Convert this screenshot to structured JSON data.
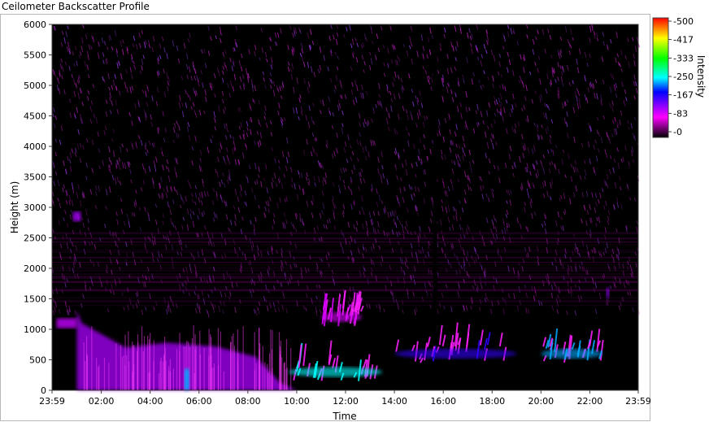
{
  "window": {
    "title": "Ceilometer Backscatter Profile"
  },
  "chart_data": {
    "type": "heatmap",
    "title": "Ceilometer Backscatter Profile",
    "xlabel": "Time",
    "ylabel": "Height (m)",
    "x_ticks": [
      "23:59",
      "02:00",
      "04:00",
      "06:00",
      "08:00",
      "10:00",
      "12:00",
      "14:00",
      "16:00",
      "18:00",
      "20:00",
      "22:00",
      "23:59"
    ],
    "x_range": [
      "23:59",
      "23:59"
    ],
    "y_ticks": [
      0,
      500,
      1000,
      1500,
      2000,
      2500,
      3000,
      3500,
      4000,
      4500,
      5000,
      5500,
      6000
    ],
    "ylim": [
      0,
      6000
    ],
    "colorbar": {
      "label": "Intensity",
      "ticks": [
        500,
        417,
        333,
        250,
        167,
        83,
        0
      ],
      "range": [
        0,
        500
      ],
      "colors": [
        "#000000",
        "#ff00ff",
        "#0000ff",
        "#00ffff",
        "#00ff00",
        "#ffff00",
        "#ff0000"
      ]
    },
    "features": [
      {
        "kind": "boundary-layer",
        "time_start": "01:00",
        "time_end": "10:00",
        "height_top": 800,
        "intensity": 120
      },
      {
        "kind": "residual-layer",
        "time_start": "00:10",
        "time_end": "01:00",
        "height": 1100,
        "intensity": 110
      },
      {
        "kind": "elevated-layer",
        "time_start": "00:50",
        "time_end": "01:10",
        "height": 2850,
        "intensity": 120
      },
      {
        "kind": "cloud-returns",
        "time_start": "09:40",
        "time_end": "13:30",
        "height": 300,
        "intensity": 250
      },
      {
        "kind": "cloud-returns",
        "time_start": "11:00",
        "time_end": "12:40",
        "height": 1200,
        "intensity": 100
      },
      {
        "kind": "cloud-returns",
        "time_start": "14:00",
        "time_end": "19:00",
        "height": 600,
        "intensity": 170
      },
      {
        "kind": "cloud-returns",
        "time_start": "20:00",
        "time_end": "22:30",
        "height": 600,
        "intensity": 230
      },
      {
        "kind": "elevated-layer",
        "time_start": "22:40",
        "time_end": "23:59",
        "height": 1600,
        "intensity": 130
      },
      {
        "kind": "data-gap",
        "time_start": "15:35",
        "time_end": "15:45"
      }
    ]
  }
}
